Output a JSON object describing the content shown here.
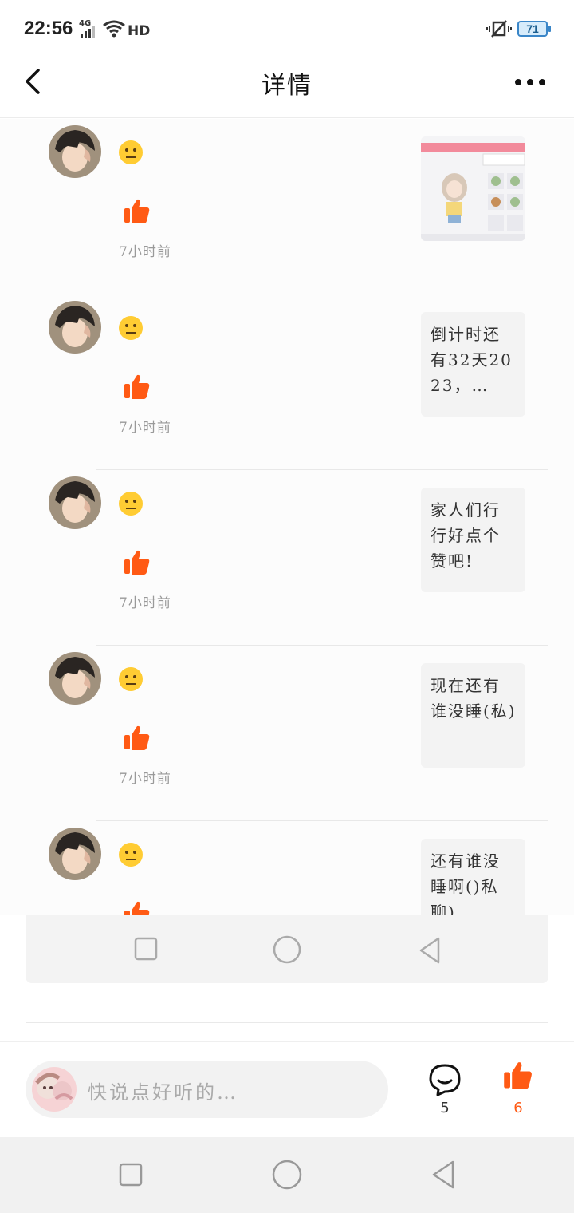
{
  "status_bar": {
    "time": "22:56",
    "network": "4G",
    "hd": "HD",
    "battery": "71"
  },
  "header": {
    "title": "详情"
  },
  "feed": {
    "items": [
      {
        "time": "7小时前",
        "content_type": "image",
        "text": ""
      },
      {
        "time": "7小时前",
        "content_type": "text",
        "text": "倒计时还有32天2023，…"
      },
      {
        "time": "7小时前",
        "content_type": "text",
        "text": "家人们行行好点个赞吧!"
      },
      {
        "time": "7小时前",
        "content_type": "text",
        "text": "现在还有谁没睡(私)"
      },
      {
        "time": "",
        "content_type": "text",
        "text": "还有谁没睡啊()私聊)"
      }
    ]
  },
  "bottom_bar": {
    "input_placeholder": "快说点好听的…",
    "comment_count": "5",
    "like_count": "6"
  },
  "colors": {
    "accent": "#ff5a14",
    "emoji": "#ffcc33"
  }
}
